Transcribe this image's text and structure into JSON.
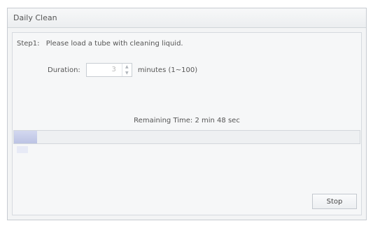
{
  "window": {
    "title": "Daily Clean"
  },
  "step": {
    "label": "Step1:",
    "instruction": "Please load a tube with cleaning liquid."
  },
  "duration": {
    "label": "Duration:",
    "value": "3",
    "unit_text": "minutes (1~100)",
    "up_icon": "chevron-up-icon",
    "down_icon": "chevron-down-icon"
  },
  "status": {
    "remaining_text": "Remaining Time: 2 min 48 sec"
  },
  "progress": {
    "fraction": 0.066,
    "fill_color": "#c6cce9"
  },
  "actions": {
    "stop_label": "Stop"
  }
}
